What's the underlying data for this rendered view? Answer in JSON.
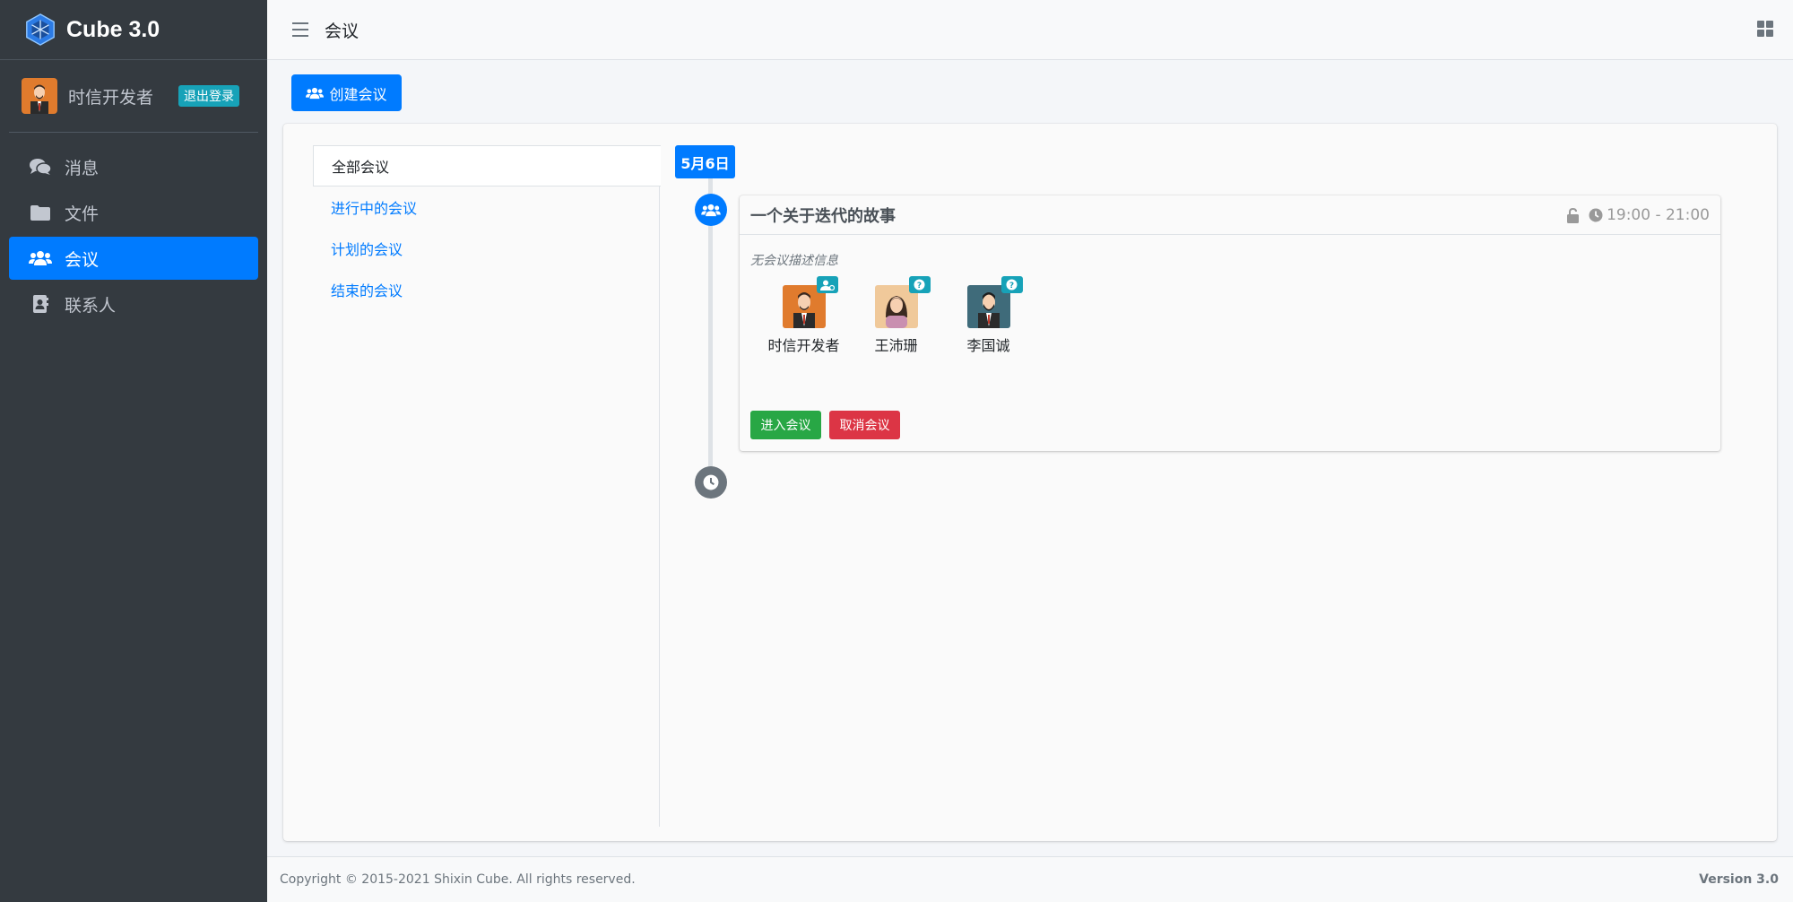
{
  "brand": {
    "title": "Cube 3.0"
  },
  "user": {
    "name": "时信开发者",
    "logout_label": "退出登录"
  },
  "sidebar": {
    "items": [
      {
        "label": "消息",
        "icon": "comments-icon",
        "active": false
      },
      {
        "label": "文件",
        "icon": "folder-icon",
        "active": false
      },
      {
        "label": "会议",
        "icon": "users-icon",
        "active": true
      },
      {
        "label": "联系人",
        "icon": "address-book-icon",
        "active": false
      }
    ]
  },
  "header": {
    "title": "会议"
  },
  "toolbar": {
    "create_label": "创建会议"
  },
  "filters": {
    "items": [
      {
        "label": "全部会议",
        "active": true
      },
      {
        "label": "进行中的会议",
        "active": false
      },
      {
        "label": "计划的会议",
        "active": false
      },
      {
        "label": "结束的会议",
        "active": false
      }
    ]
  },
  "timeline": {
    "date": "5月6日",
    "meeting": {
      "title": "一个关于迭代的故事",
      "time": "19:00 - 21:00",
      "description": "无会议描述信息",
      "participants": [
        {
          "name": "时信开发者",
          "badge": "host-icon"
        },
        {
          "name": "王沛珊",
          "badge": "question-icon"
        },
        {
          "name": "李国诚",
          "badge": "question-icon"
        }
      ],
      "join_label": "进入会议",
      "cancel_label": "取消会议"
    }
  },
  "footer": {
    "copyright": "Copyright © 2015-2021 Shixin Cube. All rights reserved.",
    "version": "Version 3.0"
  },
  "colors": {
    "primary": "#007bff",
    "sidebar": "#343a40",
    "success": "#28a745",
    "danger": "#dc3545",
    "info": "#17a2b8"
  }
}
